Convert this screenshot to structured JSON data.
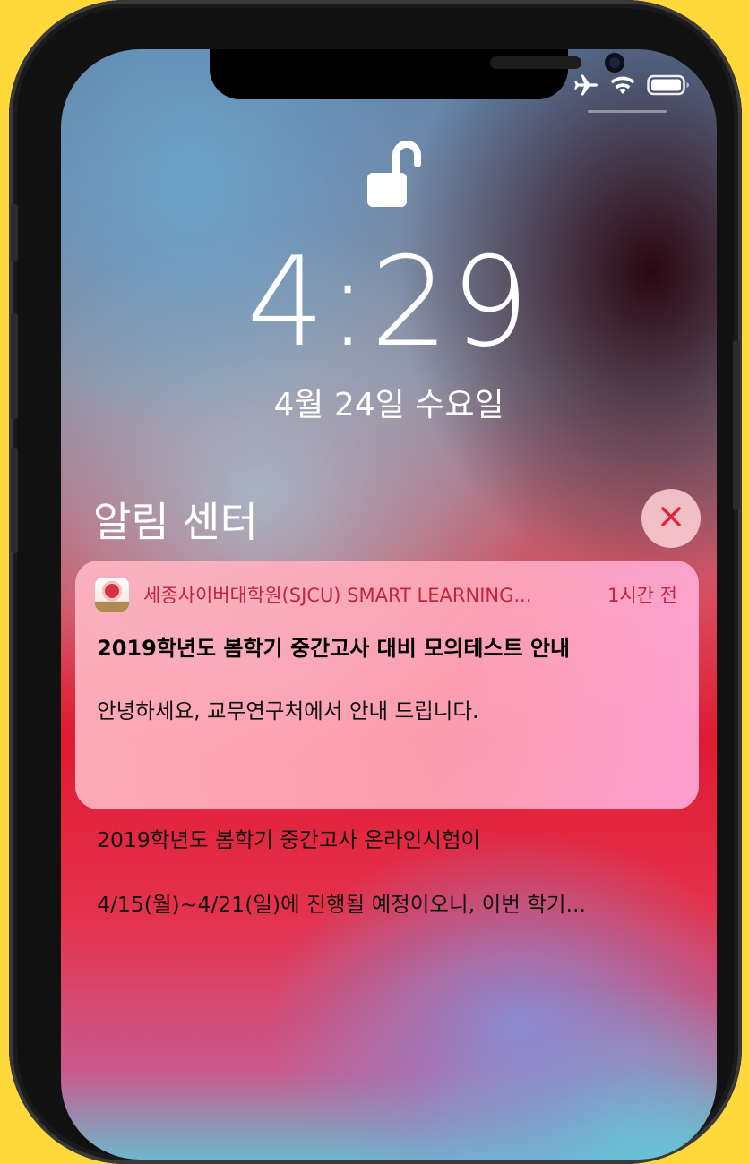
{
  "time": "4:29",
  "date": "4월 24일 수요일",
  "notification_center": {
    "title": "알림 센터"
  },
  "notification": {
    "app_name": "세종사이버대학원(SJCU) SMART LEARNING...",
    "time_ago": "1시간 전",
    "title": "2019학년도 봄학기 중간고사 대비 모의테스트 안내",
    "body_line1": "안녕하세요, 교무연구처에서 안내 드립니다.",
    "body_line2": "2019학년도 봄학기 중간고사 온라인시험이",
    "body_line3": "4/15(월)~4/21(일)에 진행될 예정이오니, 이번 학기..."
  },
  "status_bar": {
    "icons": [
      "airplane-icon",
      "wifi-icon",
      "battery-icon"
    ]
  },
  "colors": {
    "frame_background": "#ffd93b",
    "app_name_color": "#c0253d",
    "close_icon_color": "#e0253a"
  }
}
